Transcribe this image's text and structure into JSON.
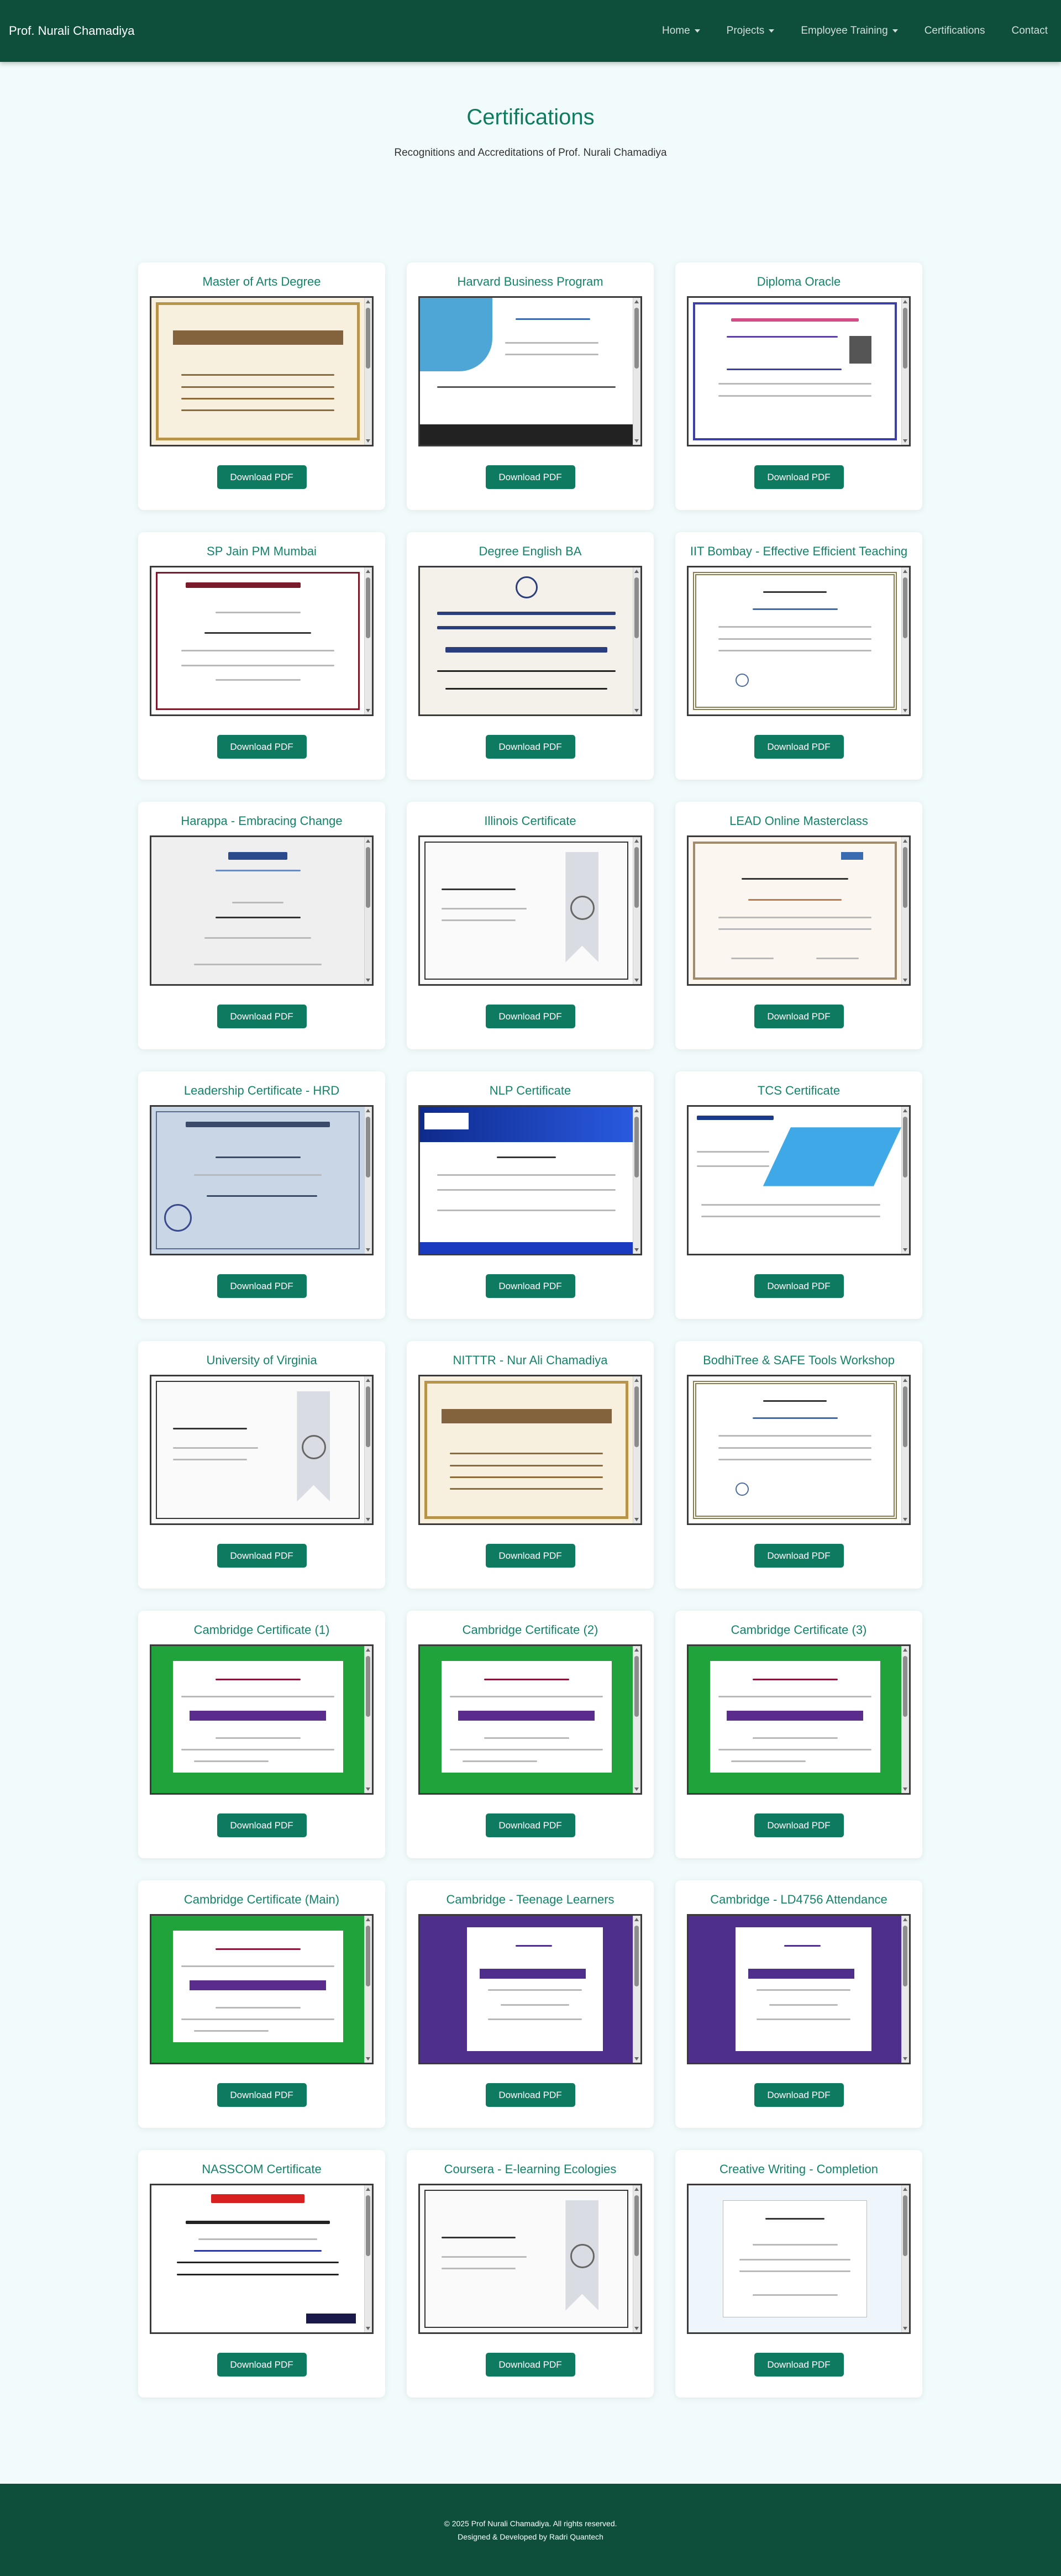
{
  "nav": {
    "brand": "Prof. Nurali Chamadiya",
    "items": [
      {
        "label": "Home",
        "dropdown": true
      },
      {
        "label": "Projects",
        "dropdown": true
      },
      {
        "label": "Employee Training",
        "dropdown": true
      },
      {
        "label": "Certifications",
        "dropdown": false
      },
      {
        "label": "Contact",
        "dropdown": false
      }
    ]
  },
  "header": {
    "title": "Certifications",
    "subtitle": "Recognitions and Accreditations of Prof. Nurali Chamadiya"
  },
  "button_label": "Download PDF",
  "certificates": [
    {
      "title": "Master of Arts Degree",
      "style": "gold"
    },
    {
      "title": "Harvard Business Program",
      "style": "blue"
    },
    {
      "title": "Diploma Oracle",
      "style": "violet"
    },
    {
      "title": "SP Jain PM Mumbai",
      "style": "maroon"
    },
    {
      "title": "Degree English BA",
      "style": "navy"
    },
    {
      "title": "IIT Bombay - Effective Efficient Teaching",
      "style": "completion"
    },
    {
      "title": "Harappa - Embracing Change",
      "style": "harappa"
    },
    {
      "title": "Illinois Certificate",
      "style": "ribbon"
    },
    {
      "title": "LEAD Online Masterclass",
      "style": "participation"
    },
    {
      "title": "Leadership Certificate - HRD",
      "style": "blueprint"
    },
    {
      "title": "NLP Certificate",
      "style": "nlp"
    },
    {
      "title": "TCS Certificate",
      "style": "tcs"
    },
    {
      "title": "University of Virginia",
      "style": "ribbon"
    },
    {
      "title": "NITTTR - Nur Ali Chamadiya",
      "style": "gold"
    },
    {
      "title": "BodhiTree & SAFE Tools Workshop",
      "style": "completion"
    },
    {
      "title": "Cambridge Certificate (1)",
      "style": "green"
    },
    {
      "title": "Cambridge Certificate (2)",
      "style": "green"
    },
    {
      "title": "Cambridge Certificate (3)",
      "style": "green"
    },
    {
      "title": "Cambridge Certificate (Main)",
      "style": "green"
    },
    {
      "title": "Cambridge - Teenage Learners",
      "style": "purple"
    },
    {
      "title": "Cambridge - LD4756 Attendance",
      "style": "purple"
    },
    {
      "title": "NASSCOM Certificate",
      "style": "nasscom"
    },
    {
      "title": "Coursera - E-learning Ecologies",
      "style": "ribbon"
    },
    {
      "title": "Creative Writing - Completion",
      "style": "floral"
    }
  ],
  "footer": {
    "copyright": "© 2025 Prof Nurali Chamadiya. All rights reserved.",
    "credit": "Designed & Developed by Radri Quantech"
  },
  "colors": {
    "nav_bg": "#0e4f3c",
    "accent": "#0e7b60",
    "title": "#14836a",
    "page_bg": "#f2fbfb"
  }
}
